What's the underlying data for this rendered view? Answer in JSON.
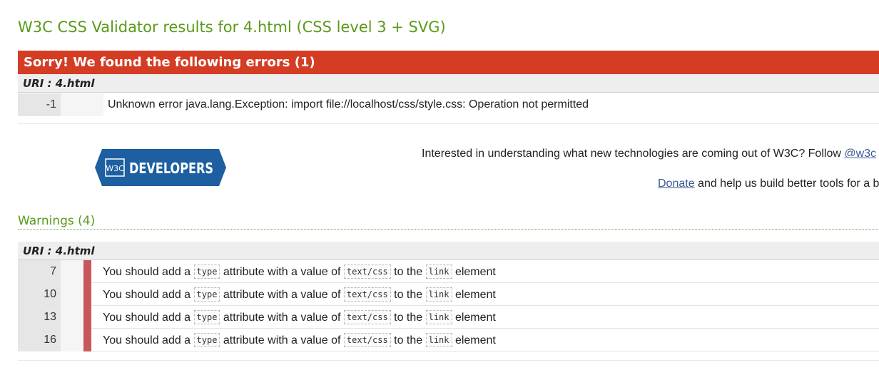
{
  "title": "W3C CSS Validator results for 4.html (CSS level 3 + SVG)",
  "errors": {
    "banner": "Sorry! We found the following errors (1)",
    "uri": "URI : 4.html",
    "items": [
      {
        "line": "-1",
        "message": "Unknown error java.lang.Exception: import file://localhost/css/style.css: Operation not permitted"
      }
    ]
  },
  "promo": {
    "logo_badge": "W3C",
    "logo_text": "DEVELOPERS",
    "interested_text": "Interested in understanding what new technologies are coming out of W3C? Follow ",
    "follow_link": "@w3c",
    "donate_link": "Donate",
    "donate_text": " and help us build better tools for a b"
  },
  "warnings": {
    "heading": "Warnings (4)",
    "uri": "URI : 4.html",
    "message_parts": {
      "p1": "You should add a ",
      "code1": "type",
      "p2": " attribute with a value of ",
      "code2": "text/css",
      "p3": " to the ",
      "code3": "link",
      "p4": " element"
    },
    "items": [
      {
        "line": "7"
      },
      {
        "line": "10"
      },
      {
        "line": "13"
      },
      {
        "line": "16"
      }
    ]
  },
  "colors": {
    "title_green": "#5a9a1a",
    "error_red": "#d43d24",
    "warning_stripe": "#c8575b",
    "link_blue": "#3b5998",
    "logo_blue": "#1d5fa0"
  }
}
